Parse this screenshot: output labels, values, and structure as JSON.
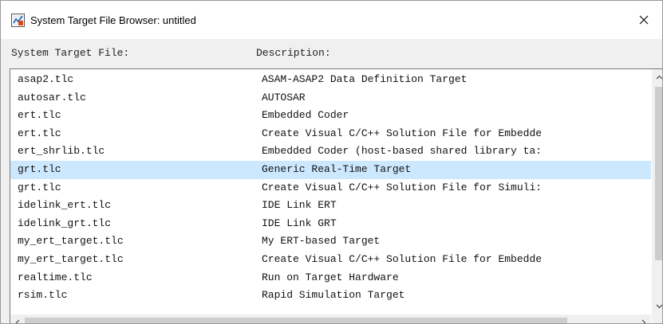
{
  "window": {
    "title": "System Target File Browser: untitled",
    "icon": "simulink-app-icon",
    "close_icon": "close-icon"
  },
  "header": {
    "file_label": "System Target File:",
    "description_label": "Description:"
  },
  "rows": [
    {
      "file": "asap2.tlc",
      "description": "ASAM-ASAP2 Data Definition Target",
      "selected": false
    },
    {
      "file": "autosar.tlc",
      "description": "AUTOSAR",
      "selected": false
    },
    {
      "file": "ert.tlc",
      "description": "Embedded Coder",
      "selected": false
    },
    {
      "file": "ert.tlc",
      "description": "Create Visual C/C++ Solution File for Embedde",
      "selected": false
    },
    {
      "file": "ert_shrlib.tlc",
      "description": "Embedded Coder (host-based shared library ta:",
      "selected": false
    },
    {
      "file": "grt.tlc",
      "description": "Generic Real-Time Target",
      "selected": true
    },
    {
      "file": "grt.tlc",
      "description": "Create Visual C/C++ Solution File for Simuli:",
      "selected": false
    },
    {
      "file": "idelink_ert.tlc",
      "description": "IDE Link ERT",
      "selected": false
    },
    {
      "file": "idelink_grt.tlc",
      "description": "IDE Link GRT",
      "selected": false
    },
    {
      "file": "my_ert_target.tlc",
      "description": "My ERT-based Target",
      "selected": false
    },
    {
      "file": "my_ert_target.tlc",
      "description": "Create Visual C/C++ Solution File for Embedde",
      "selected": false
    },
    {
      "file": "realtime.tlc",
      "description": "Run on Target Hardware",
      "selected": false
    },
    {
      "file": "rsim.tlc",
      "description": "Rapid Simulation Target",
      "selected": false
    }
  ],
  "colors": {
    "selection": "#cce8ff",
    "scrollbar_thumb": "#cdcdcd",
    "background": "#f0f0f0"
  }
}
